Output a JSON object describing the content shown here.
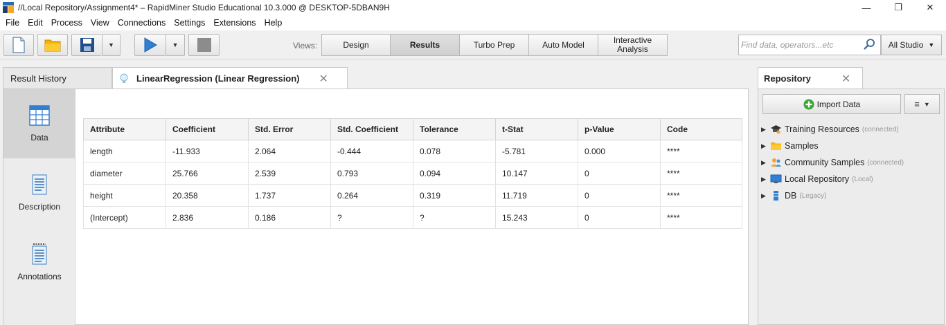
{
  "window": {
    "title": "//Local Repository/Assignment4* – RapidMiner Studio Educational 10.3.000 @ DESKTOP-5DBAN9H",
    "minimize": "—",
    "maximize": "❐",
    "close": "✕"
  },
  "menu": {
    "items": [
      {
        "label": "File"
      },
      {
        "label": "Edit"
      },
      {
        "label": "Process"
      },
      {
        "label": "View"
      },
      {
        "label": "Connections"
      },
      {
        "label": "Settings"
      },
      {
        "label": "Extensions"
      },
      {
        "label": "Help"
      }
    ]
  },
  "toolbar": {
    "views_label": "Views:",
    "views": [
      {
        "label": "Design",
        "active": false
      },
      {
        "label": "Results",
        "active": true
      },
      {
        "label": "Turbo Prep",
        "active": false
      },
      {
        "label": "Auto Model",
        "active": false
      },
      {
        "label": "Interactive Analysis",
        "active": false
      }
    ],
    "search_placeholder": "Find data, operators...etc",
    "studio_label": "All Studio"
  },
  "results": {
    "history_tab": "Result History",
    "active_tab": "LinearRegression (Linear Regression)",
    "nav": [
      {
        "label": "Data",
        "icon": "table-icon",
        "active": true
      },
      {
        "label": "Description",
        "icon": "document-icon",
        "active": false
      },
      {
        "label": "Annotations",
        "icon": "notepad-icon",
        "active": false
      }
    ],
    "table": {
      "headers": [
        "Attribute",
        "Coefficient",
        "Std. Error",
        "Std. Coefficient",
        "Tolerance",
        "t-Stat",
        "p-Value",
        "Code"
      ],
      "rows": [
        [
          "length",
          "-11.933",
          "2.064",
          "-0.444",
          "0.078",
          "-5.781",
          "0.000",
          "****"
        ],
        [
          "diameter",
          "25.766",
          "2.539",
          "0.793",
          "0.094",
          "10.147",
          "0",
          "****"
        ],
        [
          "height",
          "20.358",
          "1.737",
          "0.264",
          "0.319",
          "11.719",
          "0",
          "****"
        ],
        [
          "(Intercept)",
          "2.836",
          "0.186",
          "?",
          "?",
          "15.243",
          "0",
          "****"
        ]
      ]
    }
  },
  "repository": {
    "tab_label": "Repository",
    "import_label": "Import Data",
    "items": [
      {
        "label": "Training Resources",
        "sub": "(connected)",
        "icon": "graduation-cap-icon"
      },
      {
        "label": "Samples",
        "sub": "",
        "icon": "folder-icon"
      },
      {
        "label": "Community Samples",
        "sub": "(connected)",
        "icon": "people-icon"
      },
      {
        "label": "Local Repository",
        "sub": "(Local)",
        "icon": "monitor-icon"
      },
      {
        "label": "DB",
        "sub": "(Legacy)",
        "icon": "database-icon"
      }
    ]
  },
  "colors": {
    "play": "#2f7fd4",
    "folder": "#f5b400",
    "save": "#1f4e8a",
    "import_plus": "#3aa535"
  }
}
